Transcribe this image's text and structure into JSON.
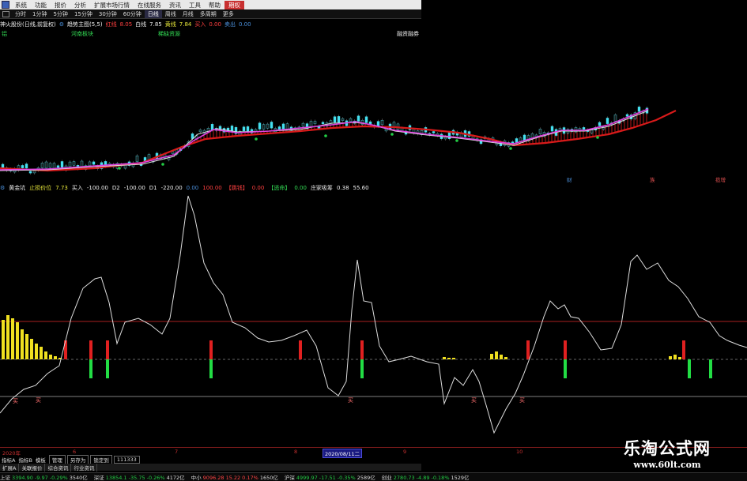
{
  "menu": {
    "items": [
      "系统",
      "功能",
      "报价",
      "分析",
      "扩展市场行情",
      "在线服务",
      "资讯",
      "工具",
      "帮助"
    ],
    "active_item": "期权"
  },
  "toolbar": {
    "items": [
      "分时",
      "1分钟",
      "5分钟",
      "15分钟",
      "30分钟",
      "60分钟",
      "日线",
      "周线",
      "月线",
      "多周期",
      "更多"
    ],
    "active": "日线"
  },
  "chart_header": {
    "stock_title": "神火股份(日线,前复权)",
    "indicator_name": "趋势主图(5,5)",
    "red_line_label": "红线",
    "red_line_value": "8.05",
    "white_line_label": "白线",
    "white_line_value": "7.85",
    "yellow_line_label": "黄线",
    "yellow_line_value": "7.84",
    "buy_label": "买入",
    "buy_value": "0.00",
    "sell_label": "卖出",
    "sell_value": "0.00"
  },
  "sector_labels": {
    "left": "铝",
    "region": "河南板块",
    "theme": "稀缺资源",
    "finance": "融资融券"
  },
  "event_tags": [
    "财",
    "族",
    "揽增"
  ],
  "lower_header": {
    "name": "黄金坑",
    "stop_label": "止损价位",
    "stop_value": "7.73",
    "buy_label": "买入",
    "buy_value": "-100.00",
    "d2_label": "D2",
    "d2_value": "-100.00",
    "d1_label": "D1",
    "d1_value": "-220.00",
    "hidden_value": "0.00",
    "value_100": "100.00",
    "break_label": "【跳钱】",
    "break_value": "0.00",
    "chase_label": "【逃命】",
    "chase_value": "0.00",
    "dealer_label": "庄家吸筹",
    "dealer_value": "0.38",
    "last_value": "55.60"
  },
  "buy_marks": [
    "买",
    "买",
    "买",
    "买",
    "买"
  ],
  "date_axis": {
    "labels": [
      "2020年",
      "6",
      "7",
      "8",
      "9",
      "10"
    ],
    "current_date": "2020/08/11二"
  },
  "bottom_tabs": {
    "row1": [
      "指标A",
      "指标B",
      "模板",
      "管理",
      "另存为"
    ],
    "lock_label": "锁定到",
    "lock_value": "111333",
    "row2": [
      "扩展A",
      "关联报价",
      "综合资讯",
      "行业资讯"
    ]
  },
  "statusbar": [
    {
      "name": "上证",
      "price": "3394.90",
      "change": "-9.97",
      "pct": "-0.29%",
      "amount": "3540亿",
      "dir": "dn"
    },
    {
      "name": "深证",
      "price": "13854.1",
      "change": "-35.75",
      "pct": "-0.26%",
      "amount": "4172亿",
      "dir": "dn"
    },
    {
      "name": "中小",
      "price": "9096.28",
      "change": "15.22",
      "pct": "0.17%",
      "amount": "1650亿",
      "dir": "up"
    },
    {
      "name": "沪深",
      "price": "4999.97",
      "change": "-17.51",
      "pct": "-0.35%",
      "amount": "2589亿",
      "dir": "dn"
    },
    {
      "name": "创业",
      "price": "2780.73",
      "change": "-4.89",
      "pct": "-0.18%",
      "amount": "1529亿",
      "dir": "dn"
    }
  ],
  "watermark": {
    "title": "乐淘公式网",
    "url": "www.60lt.com"
  },
  "colors": {
    "up": "#ff4040",
    "down": "#22cc44",
    "trend_red": "#d81a1a",
    "trend_magenta": "#e040e0",
    "oscillator_line": "#dddddd",
    "yellow_bar": "#f0e020"
  }
}
